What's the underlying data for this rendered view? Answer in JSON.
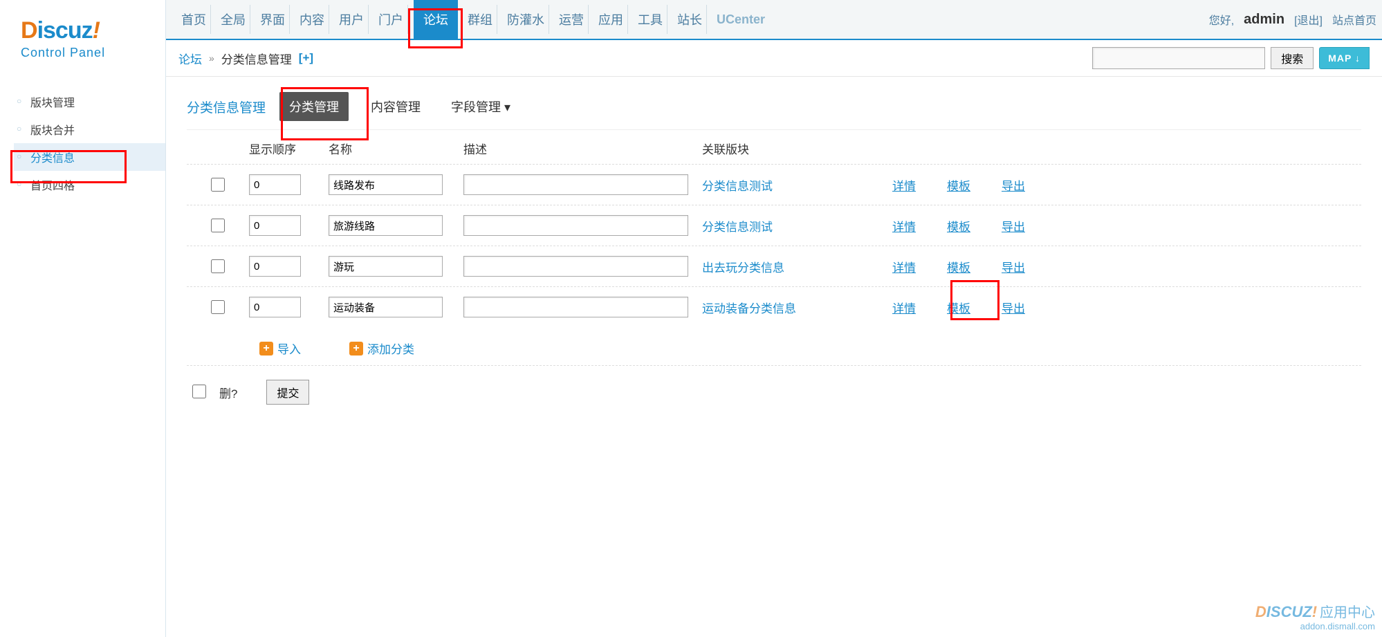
{
  "logo": {
    "brand": "Discuz",
    "sub": "Control Panel"
  },
  "top_right": {
    "greet": "您好,",
    "admin": "admin",
    "logout": "[退出]",
    "sitehome": "站点首页"
  },
  "topnav": [
    {
      "label": "首页",
      "active": false
    },
    {
      "label": "全局",
      "active": false
    },
    {
      "label": "界面",
      "active": false
    },
    {
      "label": "内容",
      "active": false
    },
    {
      "label": "用户",
      "active": false
    },
    {
      "label": "门户",
      "active": false
    },
    {
      "label": "论坛",
      "active": true
    },
    {
      "label": "群组",
      "active": false
    },
    {
      "label": "防灌水",
      "active": false
    },
    {
      "label": "运营",
      "active": false
    },
    {
      "label": "应用",
      "active": false
    },
    {
      "label": "工具",
      "active": false
    },
    {
      "label": "站长",
      "active": false
    },
    {
      "label": "UCenter",
      "active": false,
      "ucenter": true
    }
  ],
  "crumb": {
    "a": "论坛",
    "b": "分类信息管理",
    "plus": "[+]"
  },
  "search": {
    "placeholder": "",
    "value": "",
    "btn": "搜索",
    "map": "MAP ↓"
  },
  "sidebar": {
    "items": [
      {
        "label": "版块管理",
        "active": false
      },
      {
        "label": "版块合并",
        "active": false
      },
      {
        "label": "分类信息",
        "active": true
      },
      {
        "label": "首页四格",
        "active": false
      }
    ]
  },
  "section": {
    "title": "分类信息管理",
    "tabs": [
      {
        "label": "分类管理",
        "active": true
      },
      {
        "label": "内容管理",
        "active": false
      },
      {
        "label": "字段管理 ▾",
        "active": false
      }
    ]
  },
  "table": {
    "headers": {
      "order": "显示顺序",
      "name": "名称",
      "desc": "描述",
      "forum": "关联版块"
    },
    "rows": [
      {
        "order": "0",
        "name": "线路发布",
        "desc": "",
        "forum": "分类信息测试",
        "actions": [
          "详情",
          "模板",
          "导出"
        ]
      },
      {
        "order": "0",
        "name": "旅游线路",
        "desc": "",
        "forum": "分类信息测试",
        "actions": [
          "详情",
          "模板",
          "导出"
        ]
      },
      {
        "order": "0",
        "name": "游玩",
        "desc": "",
        "forum": "出去玩分类信息",
        "actions": [
          "详情",
          "模板",
          "导出"
        ]
      },
      {
        "order": "0",
        "name": "运动装备",
        "desc": "",
        "forum": "运动装备分类信息",
        "actions": [
          "详情",
          "模板",
          "导出"
        ]
      }
    ],
    "import": "导入",
    "add": "添加分类",
    "del": "删?",
    "submit": "提交"
  },
  "watermark": {
    "brand": "DISCUZ!",
    "cn": "应用中心",
    "url": "addon.dismall.com"
  }
}
